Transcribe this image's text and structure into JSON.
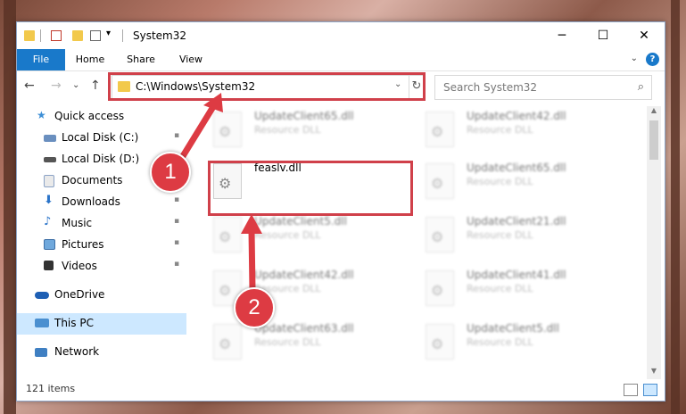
{
  "window": {
    "title": "System32",
    "minimize": "─",
    "maximize": "☐",
    "close": "✕"
  },
  "ribbon": {
    "tabs": [
      "File",
      "Home",
      "Share",
      "View"
    ],
    "help": "?",
    "collapse": "⌄"
  },
  "nav": {
    "back": "←",
    "forward": "→",
    "recent": "⌄",
    "up": "↑"
  },
  "address": {
    "path": "C:\\Windows\\System32",
    "refresh": "↻",
    "caret": "⌄"
  },
  "search": {
    "placeholder": "Search System32",
    "icon": "⌕"
  },
  "sidebar": {
    "items": [
      {
        "label": "Quick access",
        "icon": "star-icon",
        "pinned": false
      },
      {
        "label": "Local Disk (C:)",
        "icon": "drive-icon",
        "pinned": true
      },
      {
        "label": "Local Disk (D:)",
        "icon": "drive-icon",
        "pinned": true
      },
      {
        "label": "Documents",
        "icon": "documents-icon",
        "pinned": true
      },
      {
        "label": "Downloads",
        "icon": "downloads-icon",
        "pinned": true
      },
      {
        "label": "Music",
        "icon": "music-icon",
        "pinned": true
      },
      {
        "label": "Pictures",
        "icon": "pictures-icon",
        "pinned": true
      },
      {
        "label": "Videos",
        "icon": "videos-icon",
        "pinned": true
      },
      {
        "label": "OneDrive",
        "icon": "cloud-icon",
        "pinned": false
      },
      {
        "label": "This PC",
        "icon": "computer-icon",
        "pinned": false
      },
      {
        "label": "Network",
        "icon": "network-icon",
        "pinned": false
      }
    ],
    "pin_glyph": "📌"
  },
  "files": {
    "left": [
      {
        "name": "UpdateClient65.dll",
        "desc": "Resource DLL"
      },
      {
        "name": "feaslv.dll",
        "desc": ""
      },
      {
        "name": "UpdateClient5.dll",
        "desc": "Resource DLL"
      },
      {
        "name": "UpdateClient42.dll",
        "desc": "Resource DLL"
      },
      {
        "name": "UpdateClient63.dll",
        "desc": "Resource DLL"
      }
    ],
    "right": [
      {
        "name": "UpdateClient42.dll",
        "desc": "Resource DLL"
      },
      {
        "name": "UpdateClient65.dll",
        "desc": "Resource DLL"
      },
      {
        "name": "UpdateClient21.dll",
        "desc": "Resource DLL"
      },
      {
        "name": "UpdateClient41.dll",
        "desc": "Resource DLL"
      },
      {
        "name": "UpdateClient5.dll",
        "desc": "Resource DLL"
      }
    ],
    "gear_glyph": "⚙"
  },
  "status": {
    "items": "121 items"
  },
  "annotations": {
    "step1": "1",
    "step2": "2",
    "color": "#d0404a"
  },
  "colors": {
    "accent": "#1979ca",
    "selected": "#cde8ff",
    "highlight_red": "#dd3b43"
  }
}
